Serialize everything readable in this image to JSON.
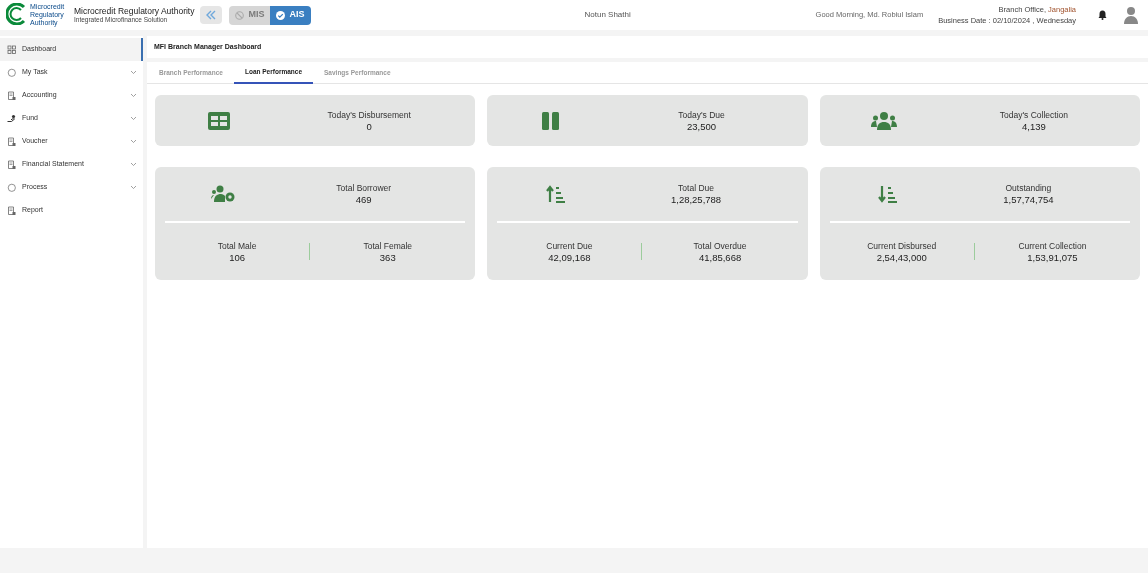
{
  "header": {
    "logo_text": "Microcredit Regulatory Authority",
    "org_name": "Microcredit Regulatory Authority",
    "org_subtitle": "Integrated Microfinance Solution",
    "modes": [
      {
        "label": "MIS",
        "selected": false
      },
      {
        "label": "AIS",
        "selected": true
      }
    ],
    "app_name": "Notun Shathi",
    "greeting": "Good Morning, Md. Robiul Islam",
    "branch_prefix": "Branch Office, ",
    "branch_name": "Jangalia",
    "business_date": "Business Date : 02/10/2024 , Wednesday"
  },
  "sidebar": {
    "items": [
      {
        "label": "Dashboard",
        "kind": "grid",
        "expandable": false,
        "selected": true
      },
      {
        "label": "My Task",
        "kind": "circle",
        "expandable": true,
        "selected": false
      },
      {
        "label": "Accounting",
        "kind": "doc",
        "expandable": true,
        "selected": false
      },
      {
        "label": "Fund",
        "kind": "hand",
        "expandable": true,
        "selected": false
      },
      {
        "label": "Voucher",
        "kind": "doc",
        "expandable": true,
        "selected": false
      },
      {
        "label": "Financial Statement",
        "kind": "doc",
        "expandable": true,
        "selected": false
      },
      {
        "label": "Process",
        "kind": "circle",
        "expandable": true,
        "selected": false
      },
      {
        "label": "Report",
        "kind": "doc",
        "expandable": false,
        "selected": false
      }
    ]
  },
  "page_title": "MFI Branch Manager Dashboard",
  "tabs": [
    {
      "label": "Branch Performance",
      "selected": false
    },
    {
      "label": "Loan Performance",
      "selected": true
    },
    {
      "label": "Savings Performance",
      "selected": false
    }
  ],
  "summary_cards": [
    {
      "kind": "table",
      "label": "Today's Disbursement",
      "value": "0"
    },
    {
      "kind": "pause",
      "label": "Today's Due",
      "value": "23,500"
    },
    {
      "kind": "people",
      "label": "Today's Collection",
      "value": "4,139"
    }
  ],
  "detail_cards": [
    {
      "kind": "people-gear",
      "label": "Total Borrower",
      "value": "469",
      "left_label": "Total Male",
      "left_value": "106",
      "right_label": "Total Female",
      "right_value": "363"
    },
    {
      "kind": "sort-up",
      "label": "Total Due",
      "value": "1,28,25,788",
      "left_label": "Current Due",
      "left_value": "42,09,168",
      "right_label": "Total Overdue",
      "right_value": "41,85,668"
    },
    {
      "kind": "sort-down",
      "label": "Outstanding",
      "value": "1,57,74,754",
      "left_label": "Current Disbursed",
      "left_value": "2,54,43,000",
      "right_label": "Current Collection",
      "right_value": "1,53,91,075"
    }
  ]
}
